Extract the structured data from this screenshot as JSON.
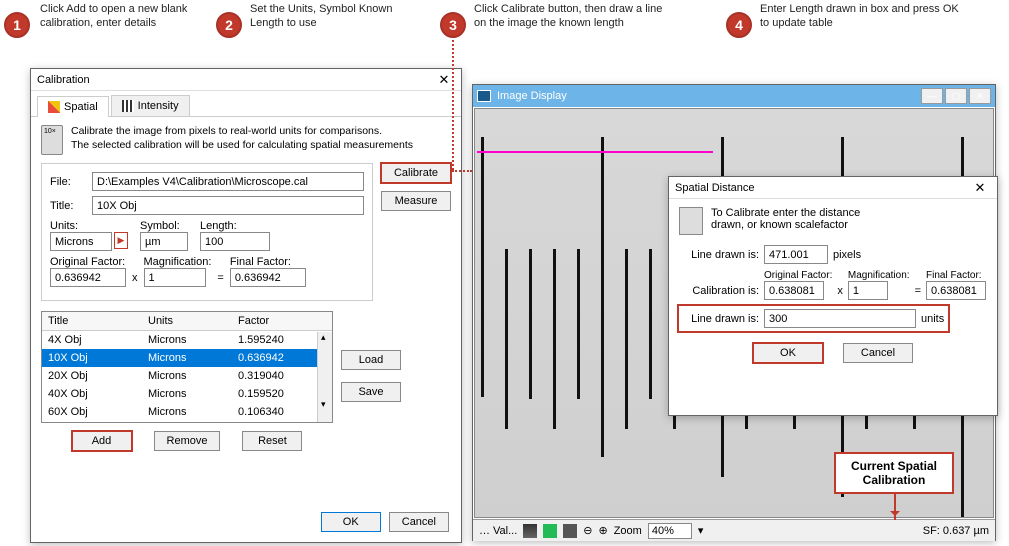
{
  "steps": {
    "s1": {
      "num": "1",
      "text": "Click Add to open a new blank calibration, enter details"
    },
    "s2": {
      "num": "2",
      "text": "Set the Units, Symbol Known Length to use"
    },
    "s3": {
      "num": "3",
      "text": "Click Calibrate button, then draw a line on the image the known length"
    },
    "s4": {
      "num": "4",
      "text": "Enter Length drawn in box and press OK to update table"
    }
  },
  "calibWin": {
    "title": "Calibration",
    "tabSpatial": "Spatial",
    "tabIntensity": "Intensity",
    "desc": "Calibrate the image from pixels to real-world units for comparisons.\nThe selected calibration will be used for calculating spatial measurements",
    "fileLabel": "File:",
    "fileVal": "D:\\Examples V4\\Calibration\\Microscope.cal",
    "titleLabel": "Title:",
    "titleVal": "10X Obj",
    "unitsLabel": "Units:",
    "unitsVal": "Microns",
    "symbolLabel": "Symbol:",
    "symbolVal": "µm",
    "lengthLabel": "Length:",
    "lengthVal": "100",
    "origLabel": "Original Factor:",
    "origVal": "0.636942",
    "magLabel": "Magnification:",
    "magVal": "1",
    "finalLabel": "Final Factor:",
    "finalVal": "0.636942",
    "xSym": "x",
    "eqSym": "=",
    "btnCalibrate": "Calibrate",
    "btnMeasure": "Measure",
    "btnLoad": "Load",
    "btnSave": "Save",
    "btnAdd": "Add",
    "btnRemove": "Remove",
    "btnReset": "Reset",
    "btnOK": "OK",
    "btnCancel": "Cancel",
    "headTitle": "Title",
    "headUnits": "Units",
    "headFactor": "Factor",
    "rows": [
      {
        "t": "4X Obj",
        "u": "Microns",
        "f": "1.595240"
      },
      {
        "t": "10X Obj",
        "u": "Microns",
        "f": "0.636942"
      },
      {
        "t": "20X Obj",
        "u": "Microns",
        "f": "0.319040"
      },
      {
        "t": "40X Obj",
        "u": "Microns",
        "f": "0.159520"
      },
      {
        "t": "60X Obj",
        "u": "Microns",
        "f": "0.106340"
      }
    ]
  },
  "imgWin": {
    "title": "Image Display",
    "valBtn": "Val...",
    "zoomLabel": "Zoom",
    "zoomVal": "40%",
    "sfLabel": "SF: 0.637 µm"
  },
  "sdWin": {
    "title": "Spatial Distance",
    "hint": "To Calibrate enter the distance drawn, or known scalefactor",
    "line1Label": "Line drawn is:",
    "line1Val": "471.001",
    "line1Unit": "pixels",
    "calibLabel": "Calibration is:",
    "origLabel": "Original Factor:",
    "origVal": "0.638081",
    "magLabel": "Magnification:",
    "magVal": "1",
    "finalLabel": "Final Factor:",
    "finalVal": "0.638081",
    "line2Label": "Line drawn is:",
    "line2Val": "300",
    "line2Unit": "units",
    "btnOK": "OK",
    "btnCancel": "Cancel",
    "x": "x",
    "eq": "="
  },
  "callout": "Current Spatial Calibration"
}
